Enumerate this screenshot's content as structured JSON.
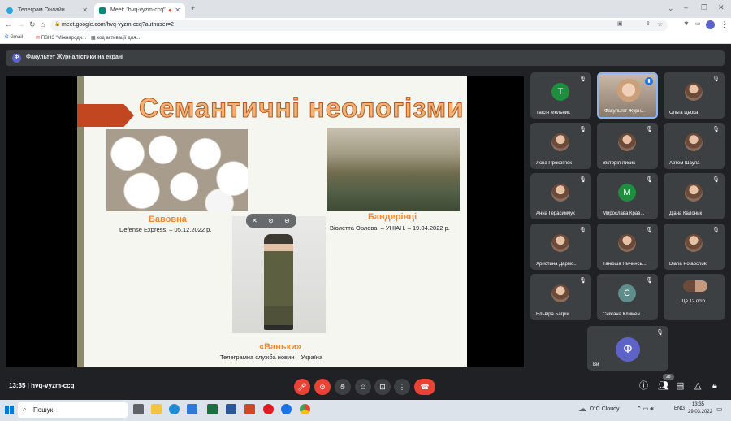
{
  "browser": {
    "tabs": [
      {
        "title": "Телеграм Онлайн",
        "active": false
      },
      {
        "title": "Meet: \"hvq-vyzm-ccq\"",
        "active": true
      }
    ],
    "url": "meet.google.com/hvq-vyzm-ccq?authuser=2",
    "bookmarks": [
      "Gmail",
      "ПВНЗ \"Міжнародн...",
      "код активації для..."
    ]
  },
  "meet": {
    "presenting_banner": "Факультет Журналістики на екрані",
    "presenter_initial": "Ф",
    "slide": {
      "title": "Семантичні неологізми",
      "items": [
        {
          "word": "Бавовна",
          "source": "Defense Express. – 05.12.2022 р."
        },
        {
          "word": "Бандерівці",
          "source": "Віолетта Орлова. – УНІАН. – 19.04.2022 р."
        },
        {
          "word": "«Ваньки»",
          "source": "Телеграмна служба новин – Україна"
        }
      ]
    },
    "participants": [
      {
        "name": "Таїсія Мельник",
        "initial": "Т",
        "color": "#1e8e3e",
        "type": "letter"
      },
      {
        "name": "Факультет Журн...",
        "initial": "",
        "color": "#8ab4f8",
        "type": "video"
      },
      {
        "name": "Ольга Цьока",
        "initial": "",
        "color": "",
        "type": "photo"
      },
      {
        "name": "Лєна Прокоп'юк",
        "initial": "",
        "color": "",
        "type": "photo"
      },
      {
        "name": "Вікторія Лисик",
        "initial": "",
        "color": "",
        "type": "photo"
      },
      {
        "name": "Артем Шаула",
        "initial": "",
        "color": "",
        "type": "photo"
      },
      {
        "name": "Анна Герасимчук",
        "initial": "",
        "color": "",
        "type": "photo"
      },
      {
        "name": "Мирослава Крав...",
        "initial": "М",
        "color": "#1e8e3e",
        "type": "letter"
      },
      {
        "name": "Діана Калоник",
        "initial": "",
        "color": "",
        "type": "photo"
      },
      {
        "name": "Христина Дармо...",
        "initial": "",
        "color": "",
        "type": "photo"
      },
      {
        "name": "Танюша Ямчинсь...",
        "initial": "",
        "color": "",
        "type": "photo"
      },
      {
        "name": "Diana Potapchuk",
        "initial": "",
        "color": "",
        "type": "photo"
      },
      {
        "name": "Ельвіра Багрій",
        "initial": "",
        "color": "",
        "type": "photo"
      },
      {
        "name": "Сніжана Климен...",
        "initial": "С",
        "color": "#5f8d8b",
        "type": "letter"
      },
      {
        "name": "Ще 12 осіб",
        "initial": "",
        "color": "",
        "type": "more"
      }
    ],
    "self": {
      "name": "Ви",
      "initial": "Ф",
      "color": "#5e64c7"
    },
    "controls": {
      "time": "13:35",
      "meeting_code": "hvq-vyzm-ccq",
      "participants_count": "28"
    }
  },
  "taskbar": {
    "search_placeholder": "Пошук",
    "weather": "0°C  Cloudy",
    "language": "ENG",
    "time": "13:35",
    "date": "29.03.2022"
  }
}
